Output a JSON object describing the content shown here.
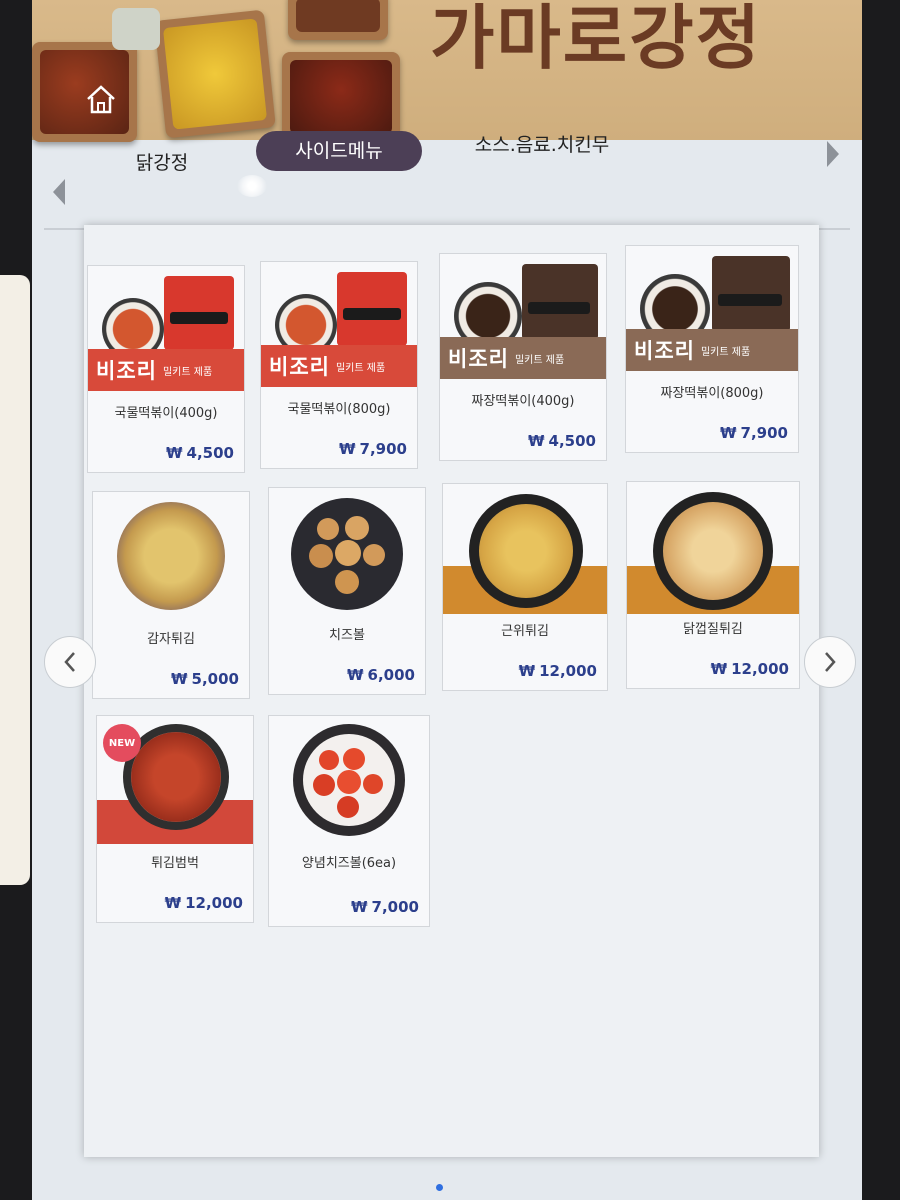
{
  "banner": {
    "title": "가마로강정"
  },
  "tabs": [
    {
      "label": "닭강정",
      "active": false
    },
    {
      "label": "사이드메뉴",
      "active": true
    },
    {
      "label": "소스.음료.치킨무",
      "active": false
    }
  ],
  "menu": {
    "currency_symbol": "₩",
    "bizori": {
      "main": "비조리",
      "sub": "밀키트 제품"
    },
    "new_badge": "NEW",
    "items": [
      {
        "name": "국물떡볶이(400g)",
        "price": "4,500"
      },
      {
        "name": "국물떡볶이(800g)",
        "price": "7,900"
      },
      {
        "name": "짜장떡볶이(400g)",
        "price": "4,500"
      },
      {
        "name": "짜장떡볶이(800g)",
        "price": "7,900"
      },
      {
        "name": "감자튀김",
        "price": "5,000"
      },
      {
        "name": "치즈볼",
        "price": "6,000"
      },
      {
        "name": "근위튀김",
        "price": "12,000"
      },
      {
        "name": "닭껍질튀김",
        "price": "12,000"
      },
      {
        "name": "튀김범벅",
        "price": "12,000"
      },
      {
        "name": "양념치즈볼(6ea)",
        "price": "7,000"
      }
    ]
  },
  "colors": {
    "active_tab": "#4c3f56",
    "price": "#2c3f8c",
    "bizori_red": "#d84a3a",
    "bizori_brown": "#8a6a56",
    "accent_orange": "#d18a2e",
    "accent_red": "#d2483a",
    "new_badge": "#e44c5e",
    "page_dot": "#2f6fe0"
  }
}
